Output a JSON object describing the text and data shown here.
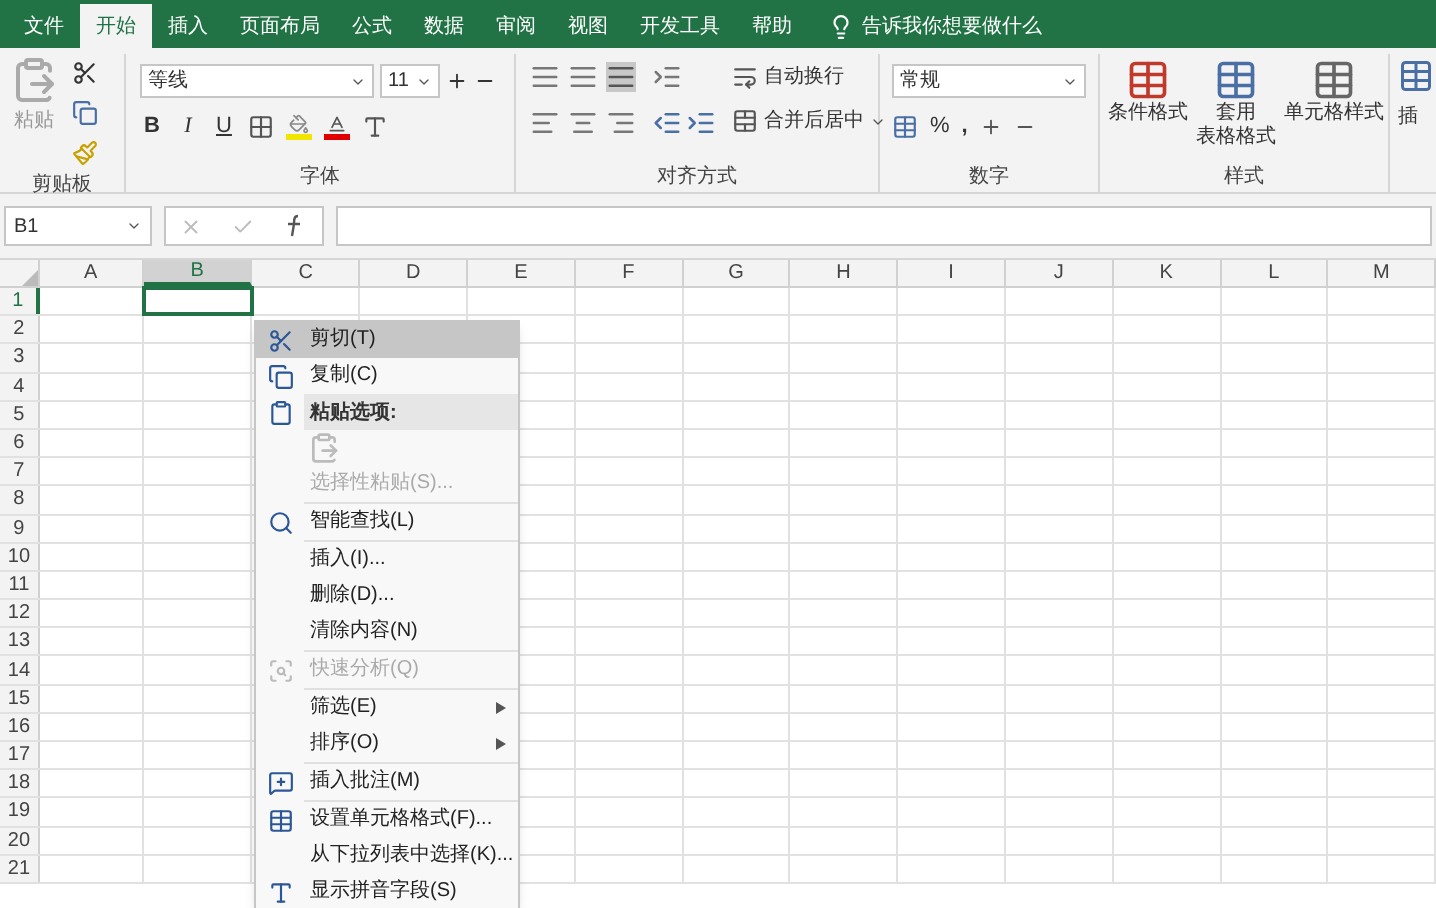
{
  "tabs": [
    {
      "label": "文件",
      "selected": false
    },
    {
      "label": "开始",
      "selected": true
    },
    {
      "label": "插入",
      "selected": false
    },
    {
      "label": "页面布局",
      "selected": false
    },
    {
      "label": "公式",
      "selected": false
    },
    {
      "label": "数据",
      "selected": false
    },
    {
      "label": "审阅",
      "selected": false
    },
    {
      "label": "视图",
      "selected": false
    },
    {
      "label": "开发工具",
      "selected": false
    },
    {
      "label": "帮助",
      "selected": false
    }
  ],
  "tell_me": "告诉我你想要做什么",
  "ribbon": {
    "clipboard": {
      "paste": "粘贴",
      "label": "剪贴板"
    },
    "font": {
      "font_name": "等线",
      "font_size": "11",
      "bold": "B",
      "italic": "I",
      "underline": "U",
      "label": "字体"
    },
    "alignment": {
      "wrap": "自动换行",
      "merge": "合并后居中",
      "label": "对齐方式"
    },
    "number": {
      "format": "常规",
      "percent": "%",
      "comma": ",",
      "label": "数字"
    },
    "styles": {
      "conditional": "条件格式",
      "table_format_1": "套用",
      "table_format_2": "表格格式",
      "cell_styles": "单元格样式",
      "label": "样式"
    },
    "cut_group": "插"
  },
  "name_box": "B1",
  "columns": [
    {
      "label": "A",
      "selected": false
    },
    {
      "label": "B",
      "selected": true
    },
    {
      "label": "C",
      "selected": false
    },
    {
      "label": "D",
      "selected": false
    },
    {
      "label": "E",
      "selected": false
    },
    {
      "label": "F",
      "selected": false
    },
    {
      "label": "G",
      "selected": false
    },
    {
      "label": "H",
      "selected": false
    },
    {
      "label": "I",
      "selected": false
    },
    {
      "label": "J",
      "selected": false
    },
    {
      "label": "K",
      "selected": false
    },
    {
      "label": "L",
      "selected": false
    },
    {
      "label": "M",
      "selected": false
    }
  ],
  "rows": [
    {
      "label": "1",
      "selected": true
    },
    {
      "label": "2",
      "selected": false
    },
    {
      "label": "3",
      "selected": false
    },
    {
      "label": "4",
      "selected": false
    },
    {
      "label": "5",
      "selected": false
    },
    {
      "label": "6",
      "selected": false
    },
    {
      "label": "7",
      "selected": false
    },
    {
      "label": "8",
      "selected": false
    },
    {
      "label": "9",
      "selected": false
    },
    {
      "label": "10",
      "selected": false
    },
    {
      "label": "11",
      "selected": false
    },
    {
      "label": "12",
      "selected": false
    },
    {
      "label": "13",
      "selected": false
    },
    {
      "label": "14",
      "selected": false
    },
    {
      "label": "15",
      "selected": false
    },
    {
      "label": "16",
      "selected": false
    },
    {
      "label": "17",
      "selected": false
    },
    {
      "label": "18",
      "selected": false
    },
    {
      "label": "19",
      "selected": false
    },
    {
      "label": "20",
      "selected": false
    },
    {
      "label": "21",
      "selected": false
    }
  ],
  "context_menu": [
    {
      "kind": "item",
      "label": "剪切(T)",
      "selected": true,
      "disabled": false,
      "submenu": false
    },
    {
      "kind": "item",
      "label": "复制(C)",
      "selected": false,
      "disabled": false,
      "submenu": false
    },
    {
      "kind": "header",
      "label": "粘贴选项:"
    },
    {
      "kind": "paste-options"
    },
    {
      "kind": "item",
      "label": "选择性粘贴(S)...",
      "selected": false,
      "disabled": true,
      "submenu": false
    },
    {
      "kind": "separator"
    },
    {
      "kind": "item",
      "label": "智能查找(L)",
      "selected": false,
      "disabled": false,
      "submenu": false
    },
    {
      "kind": "separator"
    },
    {
      "kind": "item",
      "label": "插入(I)...",
      "selected": false,
      "disabled": false,
      "submenu": false
    },
    {
      "kind": "item",
      "label": "删除(D)...",
      "selected": false,
      "disabled": false,
      "submenu": false
    },
    {
      "kind": "item",
      "label": "清除内容(N)",
      "selected": false,
      "disabled": false,
      "submenu": false
    },
    {
      "kind": "separator"
    },
    {
      "kind": "item",
      "label": "快速分析(Q)",
      "selected": false,
      "disabled": true,
      "submenu": false
    },
    {
      "kind": "separator"
    },
    {
      "kind": "item",
      "label": "筛选(E)",
      "selected": false,
      "disabled": false,
      "submenu": true
    },
    {
      "kind": "item",
      "label": "排序(O)",
      "selected": false,
      "disabled": false,
      "submenu": true
    },
    {
      "kind": "separator"
    },
    {
      "kind": "item",
      "label": "插入批注(M)",
      "selected": false,
      "disabled": false,
      "submenu": false
    },
    {
      "kind": "separator"
    },
    {
      "kind": "item",
      "label": "设置单元格格式(F)...",
      "selected": false,
      "disabled": false,
      "submenu": false
    },
    {
      "kind": "item",
      "label": "从下拉列表中选择(K)...",
      "selected": false,
      "disabled": false,
      "submenu": false
    },
    {
      "kind": "item",
      "label": "显示拼音字段(S)",
      "selected": false,
      "disabled": false,
      "submenu": false
    }
  ]
}
